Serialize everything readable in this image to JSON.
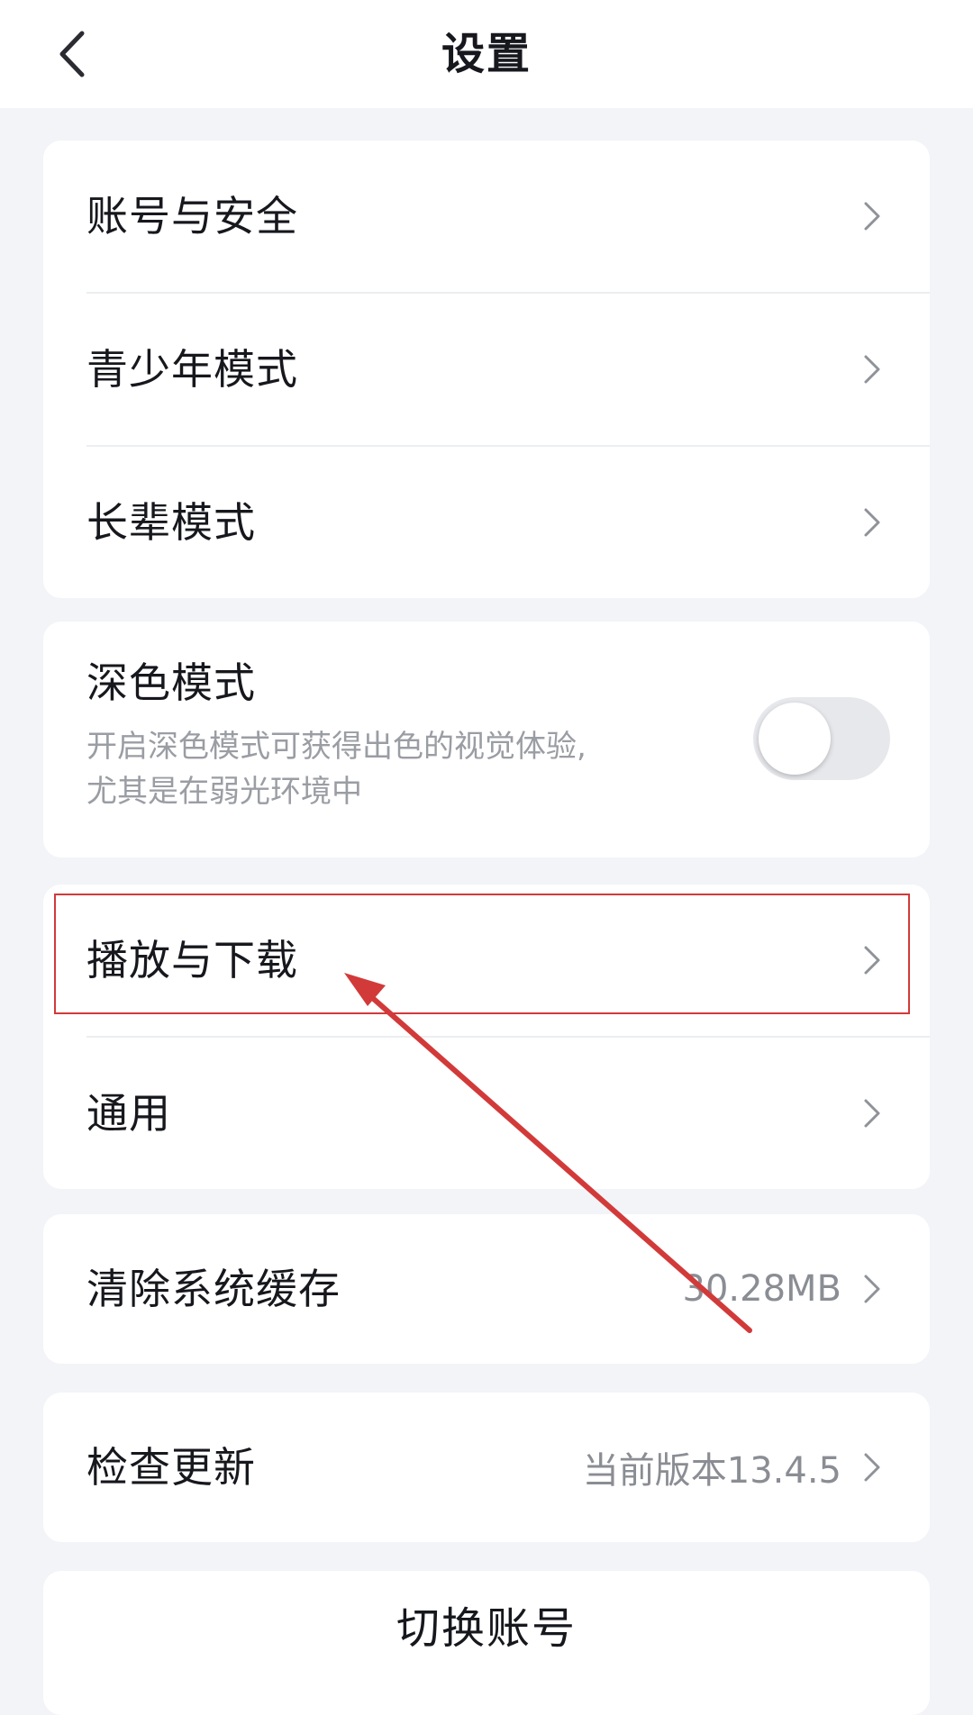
{
  "header": {
    "title": "设置",
    "back_icon": "chevron-left-icon"
  },
  "group1": {
    "items": [
      {
        "label": "账号与安全"
      },
      {
        "label": "青少年模式"
      },
      {
        "label": "长辈模式"
      }
    ]
  },
  "dark_mode": {
    "title": "深色模式",
    "desc_line1": "开启深色模式可获得出色的视觉体验,",
    "desc_line2": "尤其是在弱光环境中",
    "enabled": false
  },
  "group3": {
    "items": [
      {
        "label": "播放与下载"
      },
      {
        "label": "通用"
      }
    ]
  },
  "cache": {
    "label": "清除系统缓存",
    "value": "30.28MB"
  },
  "update": {
    "label": "检查更新",
    "value": "当前版本13.4.5"
  },
  "switch_account": {
    "label": "切换账号"
  },
  "colors": {
    "background": "#f2f4f8",
    "annotation_red": "#d23a3a",
    "muted_text": "#8a8d93"
  }
}
